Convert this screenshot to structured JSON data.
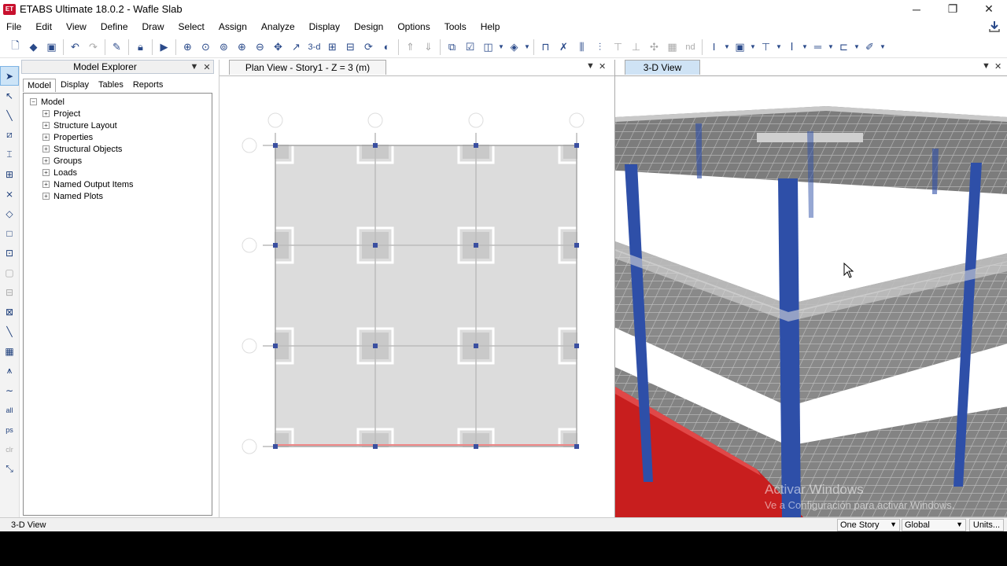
{
  "window": {
    "app_icon_text": "ET",
    "title": "ETABS Ultimate 18.0.2 - Wafle Slab",
    "minimize": "─",
    "restore": "❐",
    "close": "✕"
  },
  "menu": [
    "File",
    "Edit",
    "View",
    "Define",
    "Draw",
    "Select",
    "Assign",
    "Analyze",
    "Display",
    "Design",
    "Options",
    "Tools",
    "Help"
  ],
  "toolbar": {
    "view_3d_label": "3-d",
    "nd_label": "nd"
  },
  "explorer": {
    "title": "Model Explorer",
    "tabs": [
      "Model",
      "Display",
      "Tables",
      "Reports"
    ],
    "active_tab": "Model",
    "root": "Model",
    "items": [
      "Project",
      "Structure Layout",
      "Properties",
      "Structural Objects",
      "Groups",
      "Loads",
      "Named Output Items",
      "Named Plots"
    ]
  },
  "plan_view": {
    "tab_title": "Plan View - Story1 - Z = 3 (m)"
  },
  "view_3d": {
    "tab_title": "3-D View",
    "watermark_line1": "Activar Windows",
    "watermark_line2": "Ve a Configuración para activar Windows."
  },
  "status": {
    "text": "3-D View",
    "story_select": "One Story",
    "coord_select": "Global",
    "units_button": "Units..."
  },
  "colors": {
    "column_blue": "#2e4fa8",
    "wall_red": "#c81e1e",
    "slab_grey": "#8f8f8f",
    "plan_slab": "#dcdcdc",
    "grid_node": "#3a4fa0"
  }
}
